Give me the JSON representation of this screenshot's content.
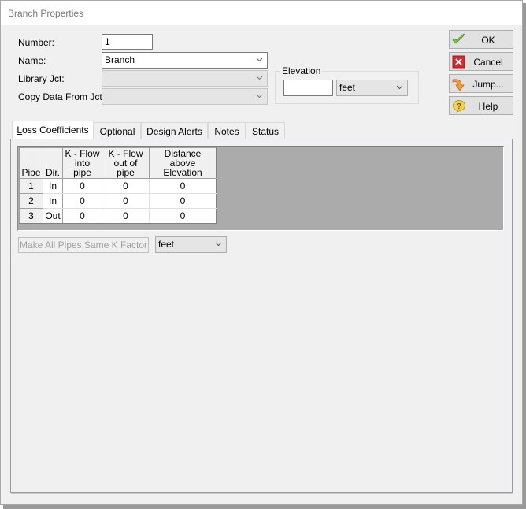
{
  "window": {
    "title": "Branch Properties"
  },
  "form": {
    "number_label": "Number:",
    "number_value": "1",
    "name_label": "Name:",
    "name_value": "Branch",
    "library_label": "Library Jct:",
    "library_value": "",
    "copy_label": "Copy Data From Jct...",
    "copy_value": ""
  },
  "elevation": {
    "group_label": "Elevation",
    "value": "",
    "unit": "feet"
  },
  "buttons": {
    "ok": {
      "label": "OK",
      "icon": "checkmark-icon"
    },
    "cancel": {
      "label": "Cancel",
      "icon": "red-x-icon"
    },
    "jump": {
      "label": "Jump...",
      "icon": "orange-arrow-icon"
    },
    "help": {
      "label": "Help",
      "icon": "question-icon"
    }
  },
  "tabs": [
    {
      "label_pre": "",
      "accel": "L",
      "label_post": "oss Coefficients",
      "active": true
    },
    {
      "label_pre": "O",
      "accel": "p",
      "label_post": "tional",
      "active": false
    },
    {
      "label_pre": "",
      "accel": "D",
      "label_post": "esign Alerts",
      "active": false
    },
    {
      "label_pre": "Not",
      "accel": "e",
      "label_post": "s",
      "active": false
    },
    {
      "label_pre": "",
      "accel": "S",
      "label_post": "tatus",
      "active": false
    }
  ],
  "grid": {
    "headers": [
      "Pipe",
      "Dir.",
      "K - Flow\ninto pipe",
      "K - Flow\nout of pipe",
      "Distance above\nElevation"
    ],
    "header_lines": [
      [
        "Pipe"
      ],
      [
        "Dir."
      ],
      [
        "K - Flow",
        "into pipe"
      ],
      [
        "K - Flow",
        "out of pipe"
      ],
      [
        "Distance above",
        "Elevation"
      ]
    ],
    "rows": [
      {
        "pipe": "1",
        "dir": "In",
        "k_in": "0",
        "k_out": "0",
        "distance": "0"
      },
      {
        "pipe": "2",
        "dir": "In",
        "k_in": "0",
        "k_out": "0",
        "distance": "0"
      },
      {
        "pipe": "3",
        "dir": "Out",
        "k_in": "0",
        "k_out": "0",
        "distance": "0"
      }
    ]
  },
  "bottom": {
    "same_k_button": "Make All Pipes Same K Factor",
    "unit": "feet"
  }
}
